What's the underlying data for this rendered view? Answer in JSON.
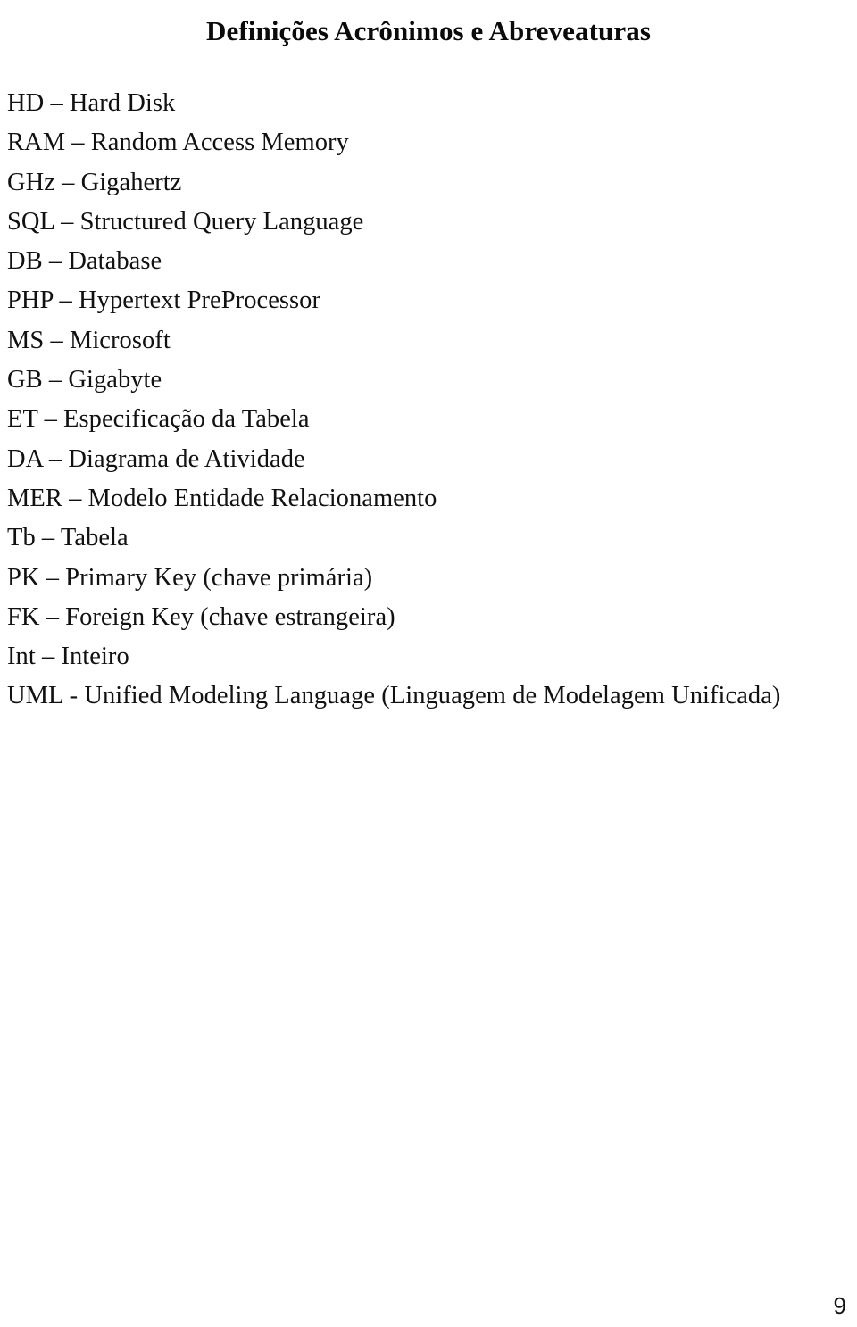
{
  "document": {
    "title": "Definições Acrônimos e Abreveaturas",
    "page_number": "9",
    "acronyms": [
      {
        "line": "HD – Hard Disk"
      },
      {
        "line": "RAM – Random Access Memory"
      },
      {
        "line": "GHz – Gigahertz"
      },
      {
        "line": "SQL – Structured Query Language"
      },
      {
        "line": "DB – Database"
      },
      {
        "line": "PHP – Hypertext PreProcessor"
      },
      {
        "line": "MS – Microsoft"
      },
      {
        "line": "GB – Gigabyte"
      },
      {
        "line": "ET – Especificação da Tabela"
      },
      {
        "line": "DA – Diagrama de Atividade"
      },
      {
        "line": "MER – Modelo Entidade Relacionamento"
      },
      {
        "line": "Tb – Tabela"
      },
      {
        "line": "PK – Primary Key (chave primária)"
      },
      {
        "line": "FK – Foreign Key (chave estrangeira)"
      },
      {
        "line": "Int – Inteiro"
      },
      {
        "line": "UML - Unified Modeling Language (Linguagem de Modelagem Unificada)"
      }
    ]
  }
}
